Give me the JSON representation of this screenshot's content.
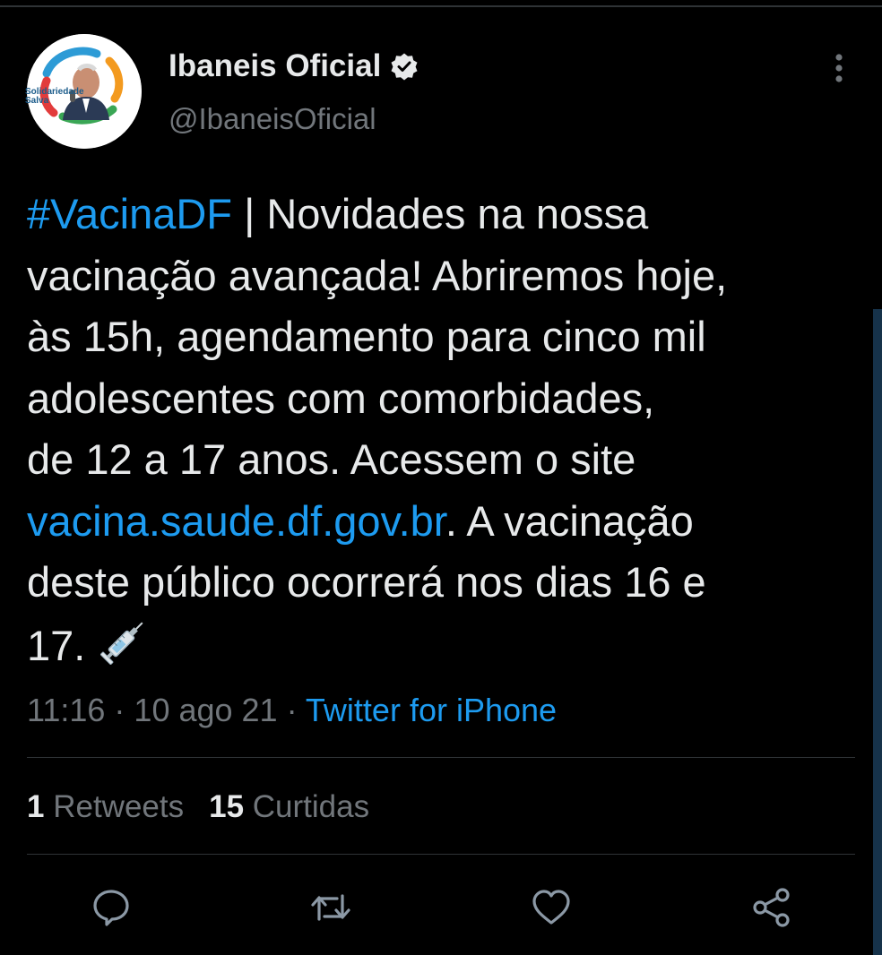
{
  "author": {
    "display_name": "Ibaneis Oficial",
    "handle": "@IbaneisOficial",
    "verified_icon": "verified-badge-icon",
    "avatar_caption": "Solidariedade Salva"
  },
  "tweet": {
    "hashtag": "#VacinaDF",
    "text_part1": " | Novidades na nossa\nvacinação avançada! Abriremos hoje,\nàs 15h, agendamento para cinco mil\nadolescentes com comorbidades,\nde 12 a 17 anos. Acessem o site\n",
    "link": "vacina.saude.df.gov.br",
    "text_part2": ". A vacinação\ndeste público ocorrerá nos dias 16 e\n17.",
    "emoji": "syringe-icon"
  },
  "meta": {
    "time": "11:16",
    "separator": " · ",
    "date": "10 ago 21",
    "source": "Twitter for iPhone"
  },
  "stats": {
    "retweets_count": "1",
    "retweets_label": "Retweets",
    "likes_count": "15",
    "likes_label": "Curtidas"
  },
  "actions": {
    "reply": "reply-icon",
    "retweet": "retweet-icon",
    "like": "heart-icon",
    "share": "share-icon"
  },
  "colors": {
    "background": "#000000",
    "text": "#e7e9ea",
    "secondary": "#71767b",
    "link": "#1d9bf0",
    "divider": "#2f3336"
  }
}
